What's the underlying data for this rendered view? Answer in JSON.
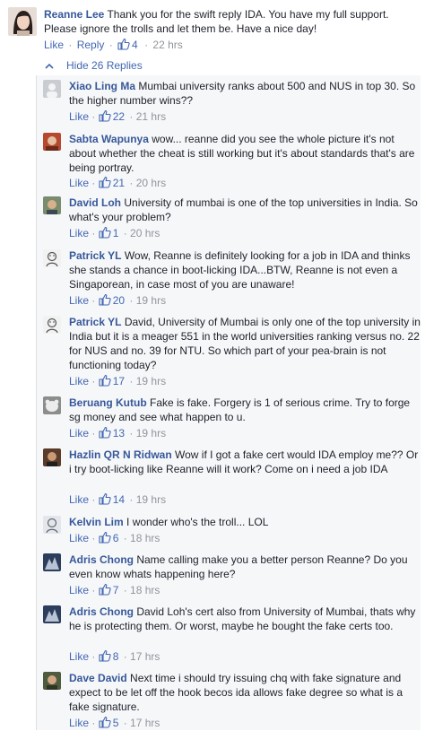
{
  "top_comment": {
    "author": "Reanne Lee",
    "text": " Thank you for the swift reply IDA. You have my full support. Please ignore the trolls and let them be. Have a nice day!",
    "like_label": "Like",
    "reply_label": "Reply",
    "likes": "4",
    "time": "22 hrs"
  },
  "hide_replies_label": "Hide 26 Replies",
  "replies": [
    {
      "author": "Xiao Ling Ma",
      "text": " Mumbai university ranks about 500 and NUS in top 30. So the higher number wins??",
      "like_label": "Like",
      "likes": "22",
      "time": "21 hrs"
    },
    {
      "author": "Sabta Wapunya",
      "text": " wow... reanne did you see the whole picture it's not about whether the cheat is still working but it's about standards that's are being portray.",
      "like_label": "Like",
      "likes": "21",
      "time": "20 hrs"
    },
    {
      "author": "David Loh",
      "text": " University of mumbai is one of the top universities in India. So what's your problem?",
      "like_label": "Like",
      "likes": "1",
      "time": "20 hrs"
    },
    {
      "author": "Patrick YL",
      "text": " Wow, Reanne is definitely looking for a job in IDA and thinks she stands a chance in boot-licking IDA...BTW, Reanne is not even a Singaporean, in case most of you are unaware!",
      "like_label": "Like",
      "likes": "20",
      "time": "19 hrs"
    },
    {
      "author": "Patrick YL",
      "text": " David, University of Mumbai is only one of the top university in India but it is a meager 551 in the world universities ranking versus no. 22 for NUS and no. 39 for NTU. So which part of your pea-brain is not functioning today?",
      "like_label": "Like",
      "likes": "17",
      "time": "19 hrs"
    },
    {
      "author": "Beruang Kutub",
      "text": " Fake is fake. Forgery is 1 of serious crime. Try to forge sg money and see what happen to u.",
      "like_label": "Like",
      "likes": "13",
      "time": "19 hrs"
    },
    {
      "author": "Hazlin QR N Ridwan",
      "text": " Wow if I got a fake cert would IDA employ me?? Or i try boot-licking like Reanne will it work? Come on i need a job IDA",
      "like_label": "Like",
      "likes": "14",
      "time": "19 hrs"
    },
    {
      "author": "Kelvin Lim",
      "text": " I wonder who's the troll... LOL",
      "like_label": "Like",
      "likes": "6",
      "time": "18 hrs"
    },
    {
      "author": "Adris Chong",
      "text": " Name calling make you a better person Reanne? Do you even know whats happening here?",
      "like_label": "Like",
      "likes": "7",
      "time": "18 hrs"
    },
    {
      "author": "Adris Chong",
      "text": " David Loh's cert also from University of Mumbai, thats why he is protecting them. Or worst, maybe he bought the fake certs too.",
      "like_label": "Like",
      "likes": "8",
      "time": "17 hrs"
    },
    {
      "author": "Dave David",
      "text": " Next time i should try issuing chq with fake signature and expect to be let off the hook becos ida allows fake degree so what is a fake signature.",
      "like_label": "Like",
      "likes": "5",
      "time": "17 hrs"
    }
  ],
  "colors": {
    "link": "#365899",
    "action": "#4267b2",
    "meta": "#90949c",
    "thread_bg": "#f6f7f9"
  }
}
